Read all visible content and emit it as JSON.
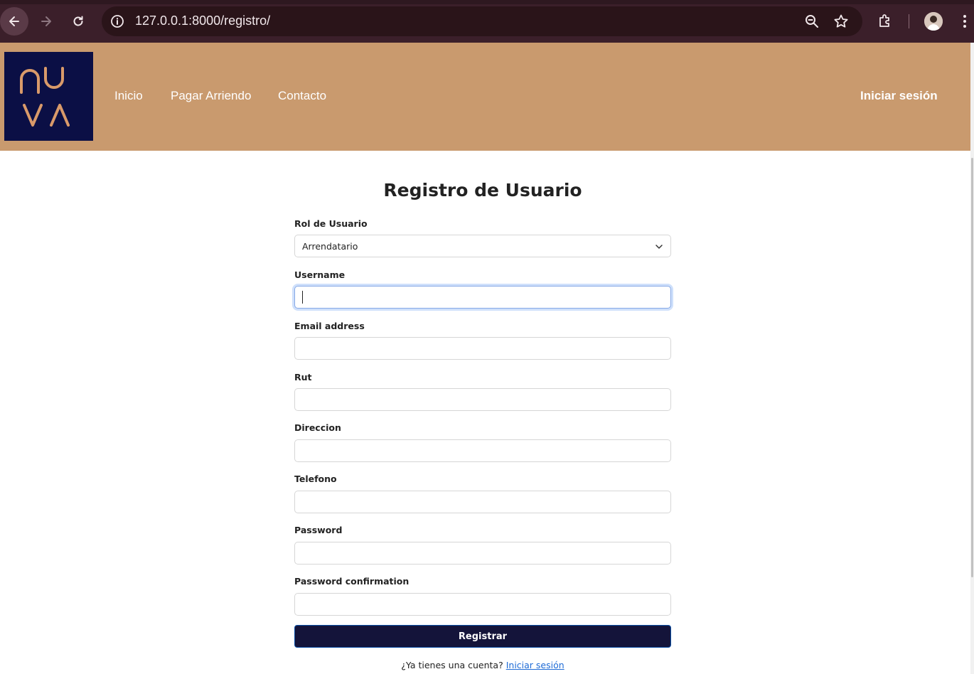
{
  "browser": {
    "url": "127.0.0.1:8000/registro/"
  },
  "header": {
    "logo_text": "NUVA",
    "nav": {
      "inicio": "Inicio",
      "pagar": "Pagar Arriendo",
      "contacto": "Contacto"
    },
    "login": "Iniciar sesión"
  },
  "form": {
    "title": "Registro de Usuario",
    "rol": {
      "label": "Rol de Usuario",
      "value": "Arrendatario"
    },
    "username": {
      "label": "Username",
      "value": ""
    },
    "email": {
      "label": "Email address",
      "value": ""
    },
    "rut": {
      "label": "Rut",
      "value": ""
    },
    "direccion": {
      "label": "Direccion",
      "value": ""
    },
    "telefono": {
      "label": "Telefono",
      "value": ""
    },
    "password": {
      "label": "Password",
      "value": ""
    },
    "password_confirmation": {
      "label": "Password confirmation",
      "value": ""
    },
    "submit": "Registrar",
    "footer_prompt": "¿Ya tienes una cuenta?",
    "footer_link": "Iniciar sesión"
  },
  "colors": {
    "header_bg": "#c99a6e",
    "logo_bg": "#0b0f45",
    "logo_stroke": "#d99a6a",
    "button_bg": "#14143a",
    "link": "#1e6bd6"
  }
}
